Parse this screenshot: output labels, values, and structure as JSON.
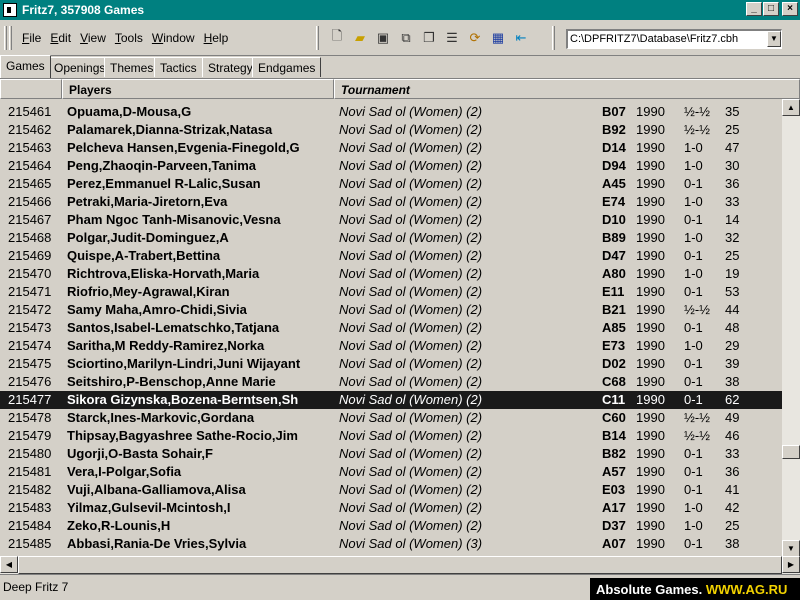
{
  "window": {
    "title": "Fritz7,  357908 Games"
  },
  "menu": [
    "File",
    "Edit",
    "View",
    "Tools",
    "Window",
    "Help"
  ],
  "toolbar_icons": [
    "new-icon",
    "open-folder-icon",
    "save-icon",
    "save-all-icon",
    "copy-icon",
    "properties-icon",
    "refresh-icon",
    "table-icon",
    "back-arrow-icon"
  ],
  "database_path": "C:\\DPFRITZ7\\Database\\Fritz7.cbh",
  "tabs": [
    "Games",
    "Openings",
    "Themes",
    "Tactics",
    "Strategy",
    "Endgames"
  ],
  "columns": {
    "players": "Players",
    "tournament": "Tournament"
  },
  "games": [
    {
      "id": "215461",
      "players": "Opuama,D-Mousa,G",
      "tournament": "Novi Sad ol (Women) (2)",
      "eco": "B07",
      "year": "1990",
      "result": "½-½",
      "moves": "35"
    },
    {
      "id": "215462",
      "players": "Palamarek,Dianna-Strizak,Natasa",
      "tournament": "Novi Sad ol (Women) (2)",
      "eco": "B92",
      "year": "1990",
      "result": "½-½",
      "moves": "25"
    },
    {
      "id": "215463",
      "players": "Pelcheva Hansen,Evgenia-Finegold,G",
      "tournament": "Novi Sad ol (Women) (2)",
      "eco": "D14",
      "year": "1990",
      "result": "1-0",
      "moves": "47"
    },
    {
      "id": "215464",
      "players": "Peng,Zhaoqin-Parveen,Tanima",
      "tournament": "Novi Sad ol (Women) (2)",
      "eco": "D94",
      "year": "1990",
      "result": "1-0",
      "moves": "30"
    },
    {
      "id": "215465",
      "players": "Perez,Emmanuel R-Lalic,Susan",
      "tournament": "Novi Sad ol (Women) (2)",
      "eco": "A45",
      "year": "1990",
      "result": "0-1",
      "moves": "36"
    },
    {
      "id": "215466",
      "players": "Petraki,Maria-Jiretorn,Eva",
      "tournament": "Novi Sad ol (Women) (2)",
      "eco": "E74",
      "year": "1990",
      "result": "1-0",
      "moves": "33"
    },
    {
      "id": "215467",
      "players": "Pham Ngoc Tanh-Misanovic,Vesna",
      "tournament": "Novi Sad ol (Women) (2)",
      "eco": "D10",
      "year": "1990",
      "result": "0-1",
      "moves": "14"
    },
    {
      "id": "215468",
      "players": "Polgar,Judit-Dominguez,A",
      "tournament": "Novi Sad ol (Women) (2)",
      "eco": "B89",
      "year": "1990",
      "result": "1-0",
      "moves": "32"
    },
    {
      "id": "215469",
      "players": "Quispe,A-Trabert,Bettina",
      "tournament": "Novi Sad ol (Women) (2)",
      "eco": "D47",
      "year": "1990",
      "result": "0-1",
      "moves": "25"
    },
    {
      "id": "215470",
      "players": "Richtrova,Eliska-Horvath,Maria",
      "tournament": "Novi Sad ol (Women) (2)",
      "eco": "A80",
      "year": "1990",
      "result": "1-0",
      "moves": "19"
    },
    {
      "id": "215471",
      "players": "Riofrio,Mey-Agrawal,Kiran",
      "tournament": "Novi Sad ol (Women) (2)",
      "eco": "E11",
      "year": "1990",
      "result": "0-1",
      "moves": "53"
    },
    {
      "id": "215472",
      "players": "Samy Maha,Amro-Chidi,Sivia",
      "tournament": "Novi Sad ol (Women) (2)",
      "eco": "B21",
      "year": "1990",
      "result": "½-½",
      "moves": "44"
    },
    {
      "id": "215473",
      "players": "Santos,Isabel-Lematschko,Tatjana",
      "tournament": "Novi Sad ol (Women) (2)",
      "eco": "A85",
      "year": "1990",
      "result": "0-1",
      "moves": "48"
    },
    {
      "id": "215474",
      "players": "Saritha,M Reddy-Ramirez,Norka",
      "tournament": "Novi Sad ol (Women) (2)",
      "eco": "E73",
      "year": "1990",
      "result": "1-0",
      "moves": "29"
    },
    {
      "id": "215475",
      "players": "Sciortino,Marilyn-Lindri,Juni Wijayant",
      "tournament": "Novi Sad ol (Women) (2)",
      "eco": "D02",
      "year": "1990",
      "result": "0-1",
      "moves": "39"
    },
    {
      "id": "215476",
      "players": "Seitshiro,P-Benschop,Anne Marie",
      "tournament": "Novi Sad ol (Women) (2)",
      "eco": "C68",
      "year": "1990",
      "result": "0-1",
      "moves": "38"
    },
    {
      "id": "215477",
      "players": "Sikora Gizynska,Bozena-Berntsen,Sh",
      "tournament": "Novi Sad ol (Women) (2)",
      "eco": "C11",
      "year": "1990",
      "result": "0-1",
      "moves": "62",
      "selected": true
    },
    {
      "id": "215478",
      "players": "Starck,Ines-Markovic,Gordana",
      "tournament": "Novi Sad ol (Women) (2)",
      "eco": "C60",
      "year": "1990",
      "result": "½-½",
      "moves": "49"
    },
    {
      "id": "215479",
      "players": "Thipsay,Bagyashree Sathe-Rocio,Jim",
      "tournament": "Novi Sad ol (Women) (2)",
      "eco": "B14",
      "year": "1990",
      "result": "½-½",
      "moves": "46"
    },
    {
      "id": "215480",
      "players": "Ugorji,O-Basta Sohair,F",
      "tournament": "Novi Sad ol (Women) (2)",
      "eco": "B82",
      "year": "1990",
      "result": "0-1",
      "moves": "33"
    },
    {
      "id": "215481",
      "players": "Vera,I-Polgar,Sofia",
      "tournament": "Novi Sad ol (Women) (2)",
      "eco": "A57",
      "year": "1990",
      "result": "0-1",
      "moves": "36"
    },
    {
      "id": "215482",
      "players": "Vuji,Albana-Galliamova,Alisa",
      "tournament": "Novi Sad ol (Women) (2)",
      "eco": "E03",
      "year": "1990",
      "result": "0-1",
      "moves": "41"
    },
    {
      "id": "215483",
      "players": "Yilmaz,Gulsevil-Mcintosh,I",
      "tournament": "Novi Sad ol (Women) (2)",
      "eco": "A17",
      "year": "1990",
      "result": "1-0",
      "moves": "42"
    },
    {
      "id": "215484",
      "players": "Zeko,R-Lounis,H",
      "tournament": "Novi Sad ol (Women) (2)",
      "eco": "D37",
      "year": "1990",
      "result": "1-0",
      "moves": "25"
    },
    {
      "id": "215485",
      "players": "Abbasi,Rania-De Vries,Sylvia",
      "tournament": "Novi Sad ol (Women) (3)",
      "eco": "A07",
      "year": "1990",
      "result": "0-1",
      "moves": "38"
    }
  ],
  "status": {
    "text": "Deep Fritz 7"
  },
  "watermark": {
    "name": "Absolute Games.",
    "site": "WWW.AG.RU"
  },
  "colors": {
    "titlebar": "#008080",
    "selection": "#1a1a1a",
    "watermark_highlight": "#f2d200"
  }
}
